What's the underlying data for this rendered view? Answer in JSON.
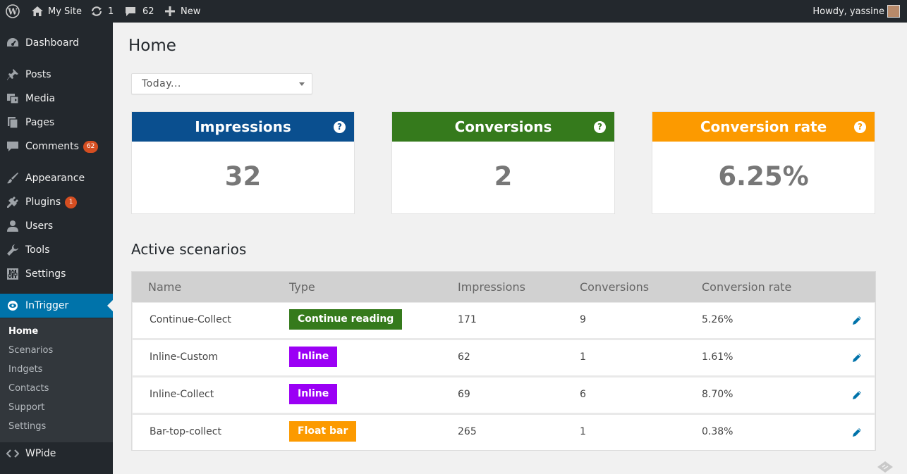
{
  "adminbar": {
    "site_name": "My Site",
    "updates_count": "1",
    "comments_count": "62",
    "new_label": "New",
    "howdy": "Howdy, yassine"
  },
  "sidebar": {
    "items": [
      {
        "label": "Dashboard"
      },
      {
        "label": "Posts"
      },
      {
        "label": "Media"
      },
      {
        "label": "Pages"
      },
      {
        "label": "Comments",
        "badge": "62"
      },
      {
        "label": "Appearance"
      },
      {
        "label": "Plugins",
        "badge": "1"
      },
      {
        "label": "Users"
      },
      {
        "label": "Tools"
      },
      {
        "label": "Settings"
      },
      {
        "label": "InTrigger"
      },
      {
        "label": "WPide"
      }
    ],
    "submenu": [
      "Home",
      "Scenarios",
      "Indgets",
      "Contacts",
      "Support",
      "Settings"
    ]
  },
  "page": {
    "title": "Home",
    "date_filter": "Today..."
  },
  "stats": [
    {
      "label": "Impressions",
      "value": "32",
      "color": "#0a4f8f"
    },
    {
      "label": "Conversions",
      "value": "2",
      "color": "#357a1c"
    },
    {
      "label": "Conversion rate",
      "value": "6.25%",
      "color": "#fc9a00"
    }
  ],
  "scenarios": {
    "title": "Active scenarios",
    "columns": [
      "Name",
      "Type",
      "Impressions",
      "Conversions",
      "Conversion rate"
    ],
    "rows": [
      {
        "name": "Continue-Collect",
        "type": "Continue reading",
        "type_color": "#357a1c",
        "impressions": "171",
        "conversions": "9",
        "rate": "5.26%"
      },
      {
        "name": "Inline-Custom",
        "type": "Inline",
        "type_color": "#9b00f5",
        "impressions": "62",
        "conversions": "1",
        "rate": "1.61%"
      },
      {
        "name": "Inline-Collect",
        "type": "Inline",
        "type_color": "#9b00f5",
        "impressions": "69",
        "conversions": "6",
        "rate": "8.70%"
      },
      {
        "name": "Bar-top-collect",
        "type": "Float bar",
        "type_color": "#fc9a00",
        "impressions": "265",
        "conversions": "1",
        "rate": "0.38%"
      }
    ]
  },
  "icons": {
    "wordpress": "wordpress-logo-icon",
    "home": "home-icon",
    "updates": "refresh-icon",
    "comments": "comment-bubble-icon",
    "new": "plus-icon",
    "edit": "pencil-icon",
    "help": "question-icon"
  }
}
